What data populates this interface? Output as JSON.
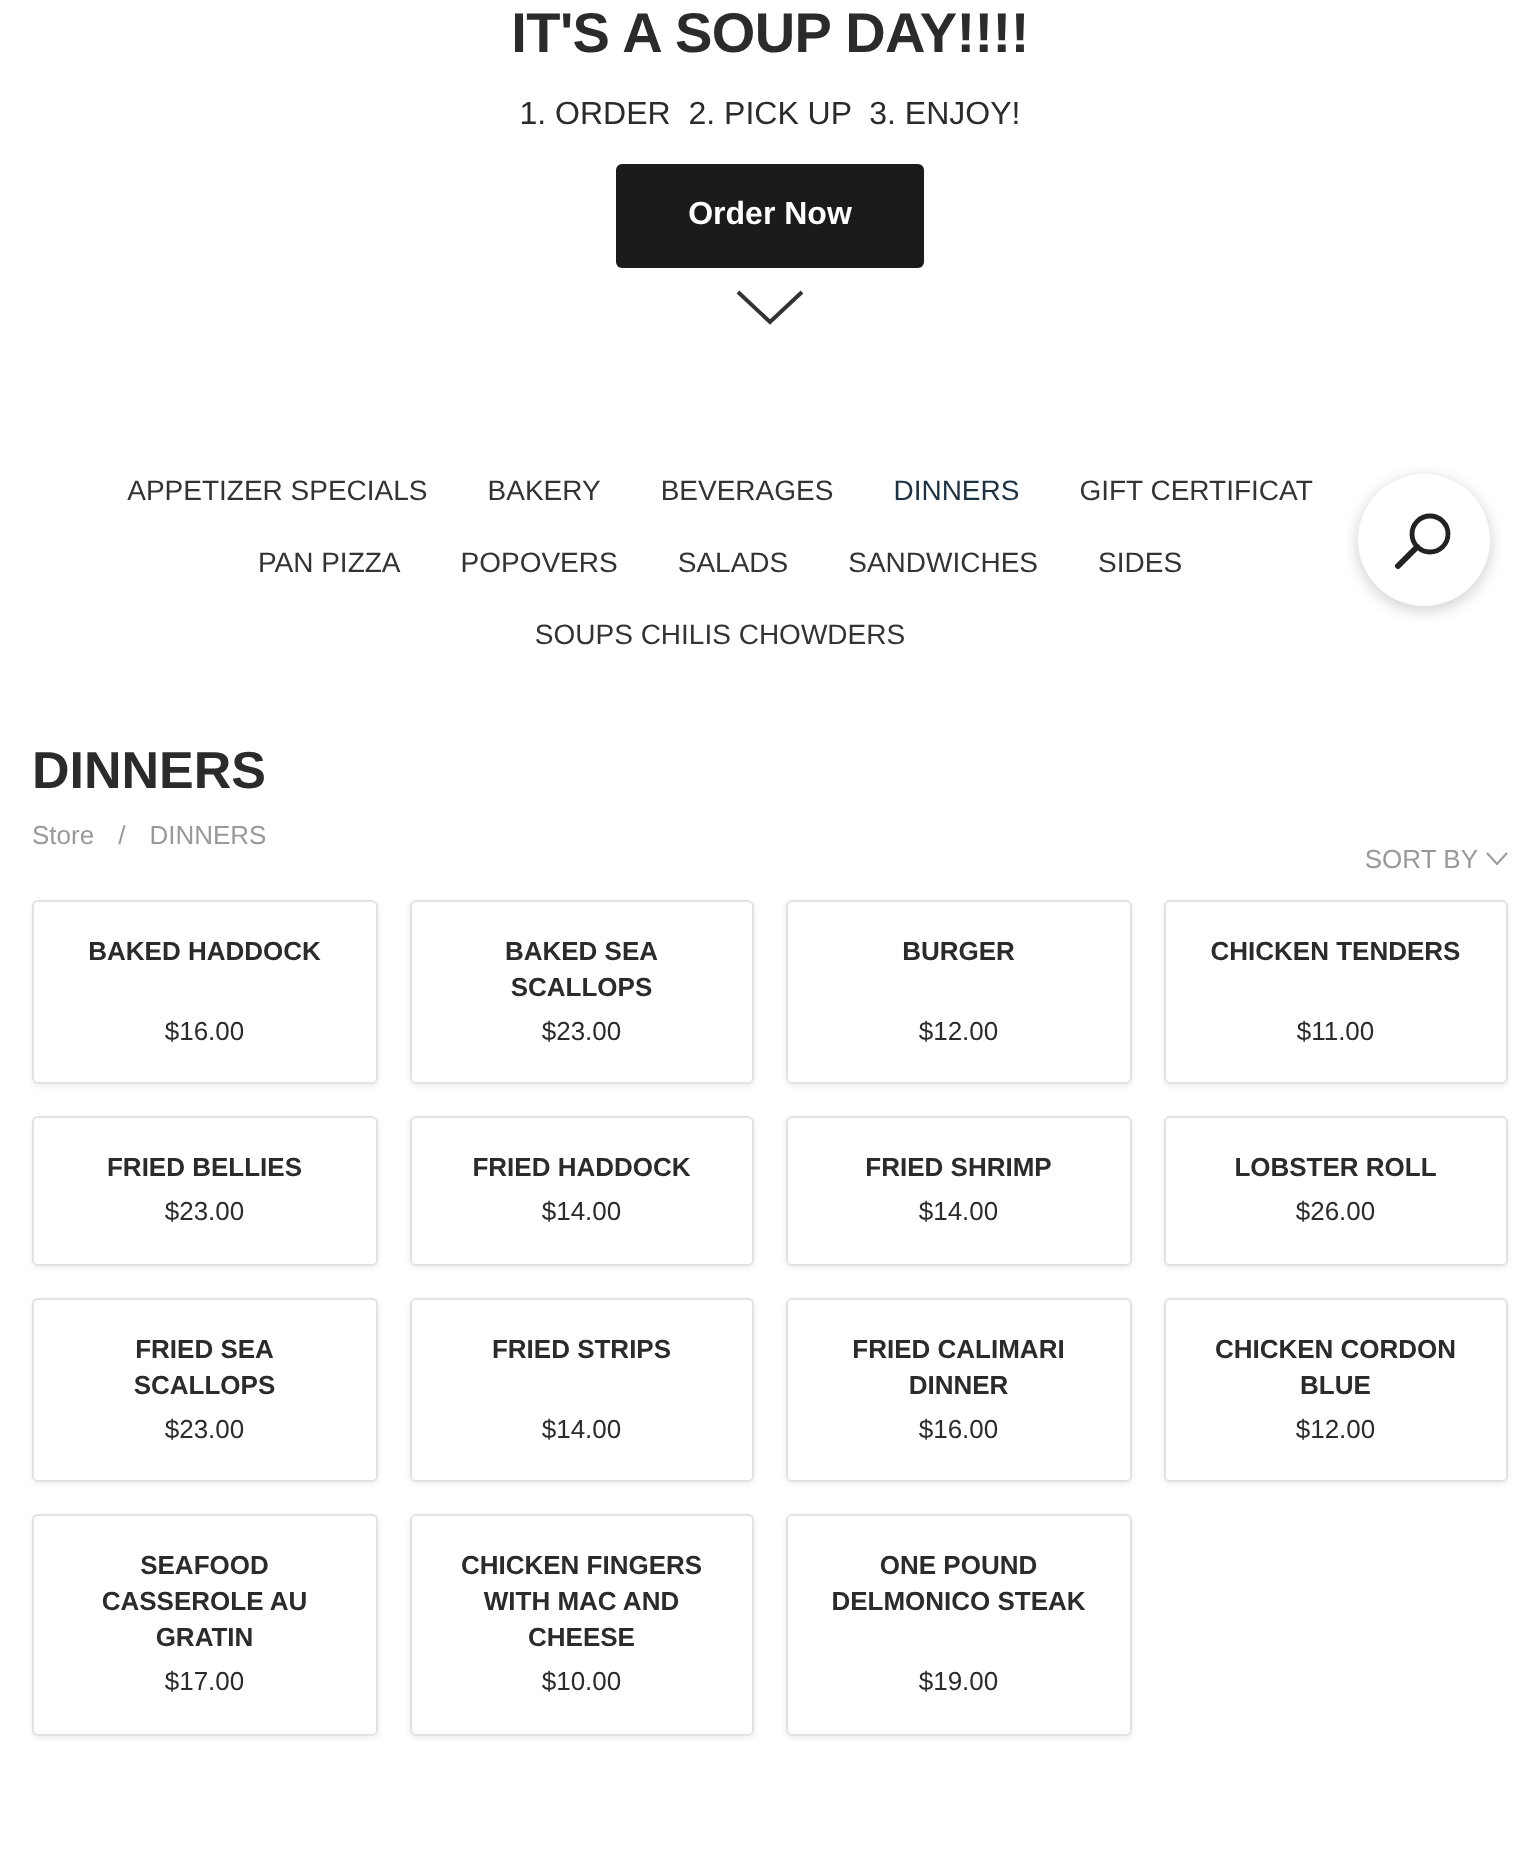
{
  "hero": {
    "title": "IT'S A SOUP DAY!!!!",
    "steps": "1. ORDER  2. PICK UP  3. ENJOY!",
    "button": "Order Now"
  },
  "categories": [
    {
      "label": "APPETIZER SPECIALS",
      "selected": false
    },
    {
      "label": "BAKERY",
      "selected": false
    },
    {
      "label": "BEVERAGES",
      "selected": false
    },
    {
      "label": "DINNERS",
      "selected": true
    },
    {
      "label": "GIFT CERTIFICAT",
      "selected": false
    },
    {
      "label": "PAN PIZZA",
      "selected": false
    },
    {
      "label": "POPOVERS",
      "selected": false
    },
    {
      "label": "SALADS",
      "selected": false
    },
    {
      "label": "SANDWICHES",
      "selected": false
    },
    {
      "label": "SIDES",
      "selected": false
    },
    {
      "label": "SOUPS CHILIS CHOWDERS",
      "selected": false
    }
  ],
  "page_title": "DINNERS",
  "breadcrumb": [
    "Store",
    "DINNERS"
  ],
  "breadcrumb_separator": "/",
  "sort_label": "SORT BY",
  "products": [
    {
      "name": "BAKED HADDOCK",
      "price": "$16.00"
    },
    {
      "name": "BAKED SEA SCALLOPS",
      "price": "$23.00"
    },
    {
      "name": "BURGER",
      "price": "$12.00"
    },
    {
      "name": "CHICKEN TENDERS",
      "price": "$11.00"
    },
    {
      "name": "FRIED BELLIES",
      "price": "$23.00"
    },
    {
      "name": "FRIED HADDOCK",
      "price": "$14.00"
    },
    {
      "name": "FRIED SHRIMP",
      "price": "$14.00"
    },
    {
      "name": "LOBSTER ROLL",
      "price": "$26.00"
    },
    {
      "name": "FRIED SEA SCALLOPS",
      "price": "$23.00"
    },
    {
      "name": "FRIED STRIPS",
      "price": "$14.00"
    },
    {
      "name": "FRIED CALIMARI DINNER",
      "price": "$16.00"
    },
    {
      "name": "CHICKEN CORDON BLUE",
      "price": "$12.00"
    },
    {
      "name": "SEAFOOD CASSEROLE AU GRATIN",
      "price": "$17.00"
    },
    {
      "name": "CHICKEN FINGERS WITH MAC AND CHEESE",
      "price": "$10.00"
    },
    {
      "name": "ONE POUND DELMONICO STEAK",
      "price": "$19.00"
    }
  ]
}
